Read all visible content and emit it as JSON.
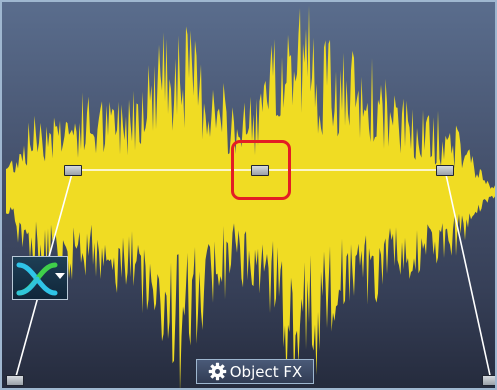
{
  "clip": {
    "waveform_color": "#f0dc23",
    "envelope_color": "#ffffff",
    "background_top_color": "#5a6d8d",
    "background_bottom_color": "#252b3d",
    "border_color": "#9fb7d0",
    "selection_color": "#e31e24",
    "handles": [
      {
        "name": "fade-in-start-handle"
      },
      {
        "name": "fade-in-end-handle"
      },
      {
        "name": "volume-handle"
      },
      {
        "name": "fade-out-start-handle"
      },
      {
        "name": "fade-out-end-handle"
      }
    ]
  },
  "crossfade_icon": "crossfade-icon",
  "object_fx": {
    "label": "Object FX",
    "icon": "gear-icon"
  }
}
